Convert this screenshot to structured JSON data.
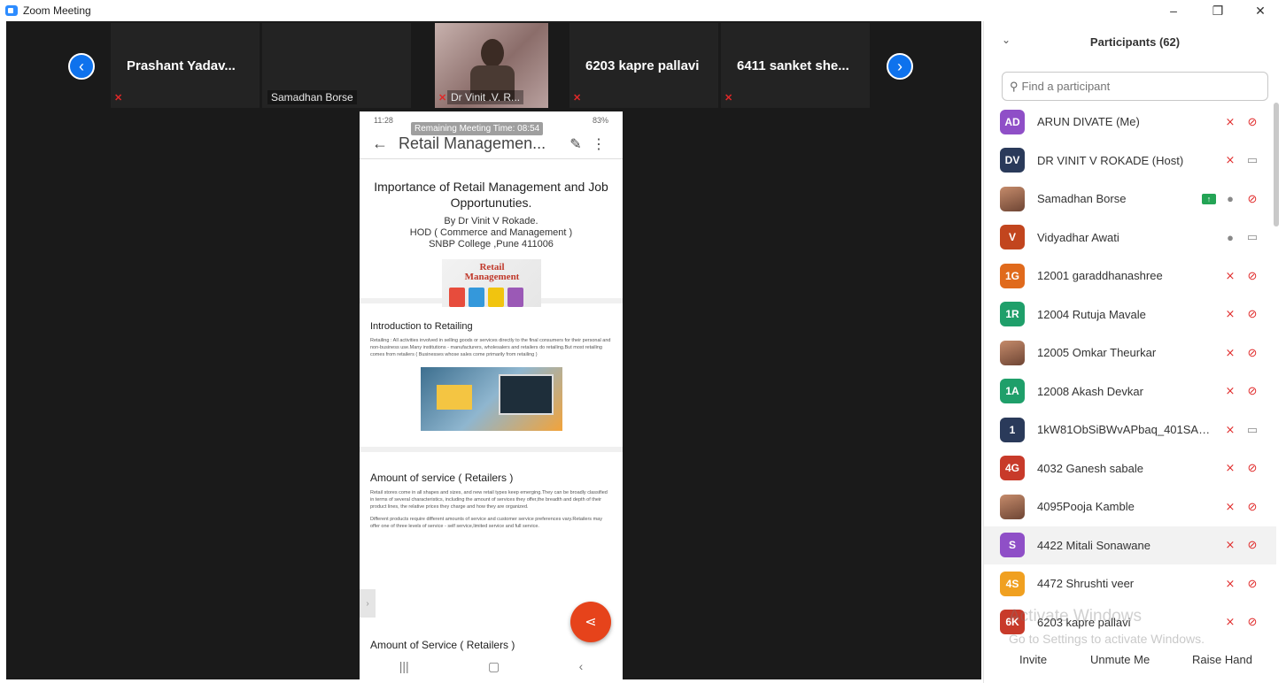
{
  "window": {
    "title": "Zoom Meeting",
    "controls": [
      "–",
      "❐",
      "✕"
    ]
  },
  "strip": {
    "prev_icon": "chevron-left-icon",
    "next_icon": "chevron-right-icon",
    "tiles": [
      {
        "name": "Prashant  Yadav...",
        "label": "",
        "muted": true
      },
      {
        "name": "",
        "label": "Samadhan Borse",
        "muted": false
      },
      {
        "name": "",
        "label": "Dr Vinit .V. R...",
        "muted": true,
        "video": true
      },
      {
        "name": "6203 kapre pallavi",
        "label": "",
        "muted": true
      },
      {
        "name": "6411 sanket she...",
        "label": "",
        "muted": true
      }
    ]
  },
  "phone": {
    "status_left": "11:28",
    "status_right": "83%",
    "timer": "Remaining Meeting Time: 08:54",
    "appbar_title": "Retail Managemen...",
    "slide1": {
      "title": "Importance of Retail Management and Job Opportunuties.",
      "by": "By Dr Vinit V Rokade.",
      "dept": "HOD ( Commerce and Management )",
      "college": "SNBP College ,Pune 411006",
      "logo_text": "Retail Management"
    },
    "slide2": {
      "heading": "Introduction to Retailing",
      "body": "Retailing : All activities involved in selling goods or services directly to the final consumers for their personal and non-business use.Many institutions - manufacturers, wholesalers and retailers do retailing.But most retailing comes from retailers ( Businesses whose sales come primarily from retailing )"
    },
    "slide3": {
      "heading": "Amount of service ( Retailers )",
      "body1": "Retail stores come in all shapes and sizes, and new retail types keep emerging.They can be broadly classified in terms of several characteristics, including the amount of services they offer,the breadth and depth of their product lines, the relative prices they charge and how they are organized.",
      "body2": "Different products require different amounts of service and customer service preferences vary.Retailers may offer one of three levels of service - self service,limited service and full service."
    },
    "next_slide": "Amount of Service ( Retailers )",
    "nav": [
      "|||",
      "▢",
      "‹"
    ]
  },
  "panel": {
    "title": "Participants (62)",
    "search_placeholder": "Find a participant",
    "participants": [
      {
        "avatar": "AD",
        "color": "#8f4fc7",
        "name": "ARUN DIVATE (Me)",
        "mic": "muted",
        "cam": "off"
      },
      {
        "avatar": "DV",
        "color": "#2a3a5a",
        "name": "DR VINIT V ROKADE (Host)",
        "mic": "muted",
        "cam": "neutral"
      },
      {
        "avatar": "",
        "color": "photo",
        "name": "Samadhan Borse",
        "mic": "neutral",
        "cam": "off",
        "share": true
      },
      {
        "avatar": "V",
        "color": "#c2451e",
        "name": "Vidyadhar Awati",
        "mic": "neutral",
        "cam": "neutral"
      },
      {
        "avatar": "1G",
        "color": "#e06a1c",
        "name": "12001 garaddhanashree",
        "mic": "muted",
        "cam": "off"
      },
      {
        "avatar": "1R",
        "color": "#1f9f6a",
        "name": "12004  Rutuja Mavale",
        "mic": "muted",
        "cam": "off"
      },
      {
        "avatar": "",
        "color": "photo",
        "name": "12005 Omkar Theurkar",
        "mic": "muted",
        "cam": "off"
      },
      {
        "avatar": "1A",
        "color": "#1f9f6a",
        "name": "12008 Akash Devkar",
        "mic": "muted",
        "cam": "off"
      },
      {
        "avatar": "1",
        "color": "#2a3a5a",
        "name": "1kW81ObSiBWvAPbaq_401SAA...",
        "mic": "muted",
        "cam": "neutral"
      },
      {
        "avatar": "4G",
        "color": "#c83a2a",
        "name": "4032 Ganesh sabale",
        "mic": "muted",
        "cam": "off"
      },
      {
        "avatar": "",
        "color": "photo",
        "name": "4095Pooja Kamble",
        "mic": "muted",
        "cam": "off"
      },
      {
        "avatar": "S",
        "color": "#8f4fc7",
        "name": "4422 Mitali Sonawane",
        "mic": "muted",
        "cam": "off",
        "highlight": true
      },
      {
        "avatar": "4S",
        "color": "#f0a020",
        "name": "4472 Shrushti  veer",
        "mic": "muted",
        "cam": "off"
      },
      {
        "avatar": "6K",
        "color": "#c83a2a",
        "name": "6203 kapre pallavi",
        "mic": "muted",
        "cam": "off"
      }
    ],
    "watermark_line1": "Activate Windows",
    "watermark_line2": "Go to Settings to activate Windows.",
    "footer": {
      "invite": "Invite",
      "unmute": "Unmute Me",
      "raise": "Raise Hand"
    }
  }
}
